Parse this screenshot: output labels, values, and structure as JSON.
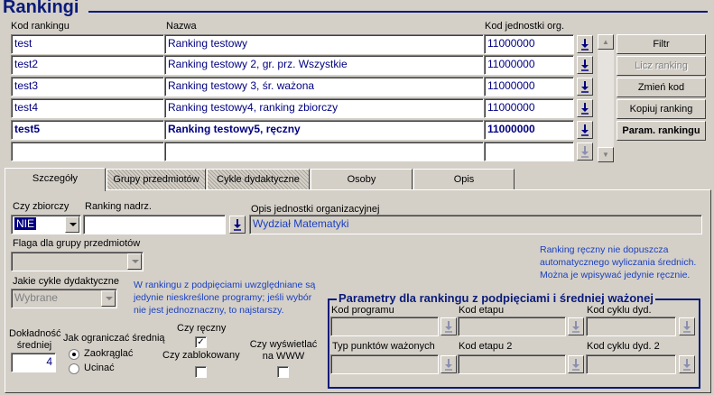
{
  "title": "Rankingi",
  "grid": {
    "headers": {
      "code": "Kod rankingu",
      "name": "Nazwa",
      "unit": "Kod jednostki org."
    },
    "rows": [
      {
        "code": "test",
        "name": "Ranking testowy",
        "unit": "11000000"
      },
      {
        "code": "test2",
        "name": "Ranking testowy 2, gr. prz. Wszystkie",
        "unit": "11000000"
      },
      {
        "code": "test3",
        "name": "Ranking testowy 3, śr. ważona",
        "unit": "11000000"
      },
      {
        "code": "test4",
        "name": "Ranking testowy4, ranking zbiorczy",
        "unit": "11000000"
      },
      {
        "code": "test5",
        "name": "Ranking testowy5, ręczny",
        "unit": "11000000"
      },
      {
        "code": "",
        "name": "",
        "unit": ""
      }
    ]
  },
  "buttons": {
    "filter": "Filtr",
    "compute": "Licz ranking",
    "change_code": "Zmień kod",
    "copy": "Kopiuj ranking",
    "params": "Param. rankingu"
  },
  "tabs": [
    "Szczegóły",
    "Grupy przedmiotów",
    "Cykle dydaktyczne",
    "Osoby",
    "Opis"
  ],
  "details": {
    "aggregate_label": "Czy zbiorczy",
    "aggregate_value": "NIE",
    "parent_label": "Ranking nadrz.",
    "parent_value": "",
    "unit_desc_label": "Opis jednostki organizacyjnej",
    "unit_desc_value": "Wydział Matematyki",
    "subject_flag_label": "Flaga dla grupy przedmiotów",
    "subject_flag_value": "",
    "cycles_label": "Jakie cykle dydaktyczne",
    "cycles_value": "Wybrane",
    "cycles_note": [
      "W rankingu z podpięciami uwzględniane są",
      "jedynie nieskreślone programy; jeśli wybór",
      "nie jest jednoznaczny, to najstarszy."
    ],
    "manual_note": [
      "Ranking ręczny nie dopuszcza",
      "automatycznego wyliczania średnich.",
      "Można je wpisywać jedynie ręcznie."
    ],
    "precision_label": [
      "Dokładność",
      "średniej"
    ],
    "precision_value": "4",
    "rounding_label": "Jak ograniczać średnią",
    "rounding_options": [
      "Zaokrąglać",
      "Ucinać"
    ],
    "manual_label": "Czy ręczny",
    "manual_checked": "✓",
    "locked_label": "Czy zablokowany",
    "www_label": [
      "Czy wyświetlać",
      "na WWW"
    ]
  },
  "params_group": {
    "title": "Parametry dla rankingu z podpięciami i średniej ważonej",
    "program_code": "Kod programu",
    "stage_code": "Kod etapu",
    "cycle_code": "Kod cyklu dyd.",
    "points_type": "Typ punktów ważonych",
    "stage_code2": "Kod etapu 2",
    "cycle_code2": "Kod cyklu dyd. 2"
  },
  "colors": {
    "accent": "#0a1a7a",
    "field_text": "#000080",
    "note": "#1a3fc0",
    "face": "#d4d0c8"
  }
}
